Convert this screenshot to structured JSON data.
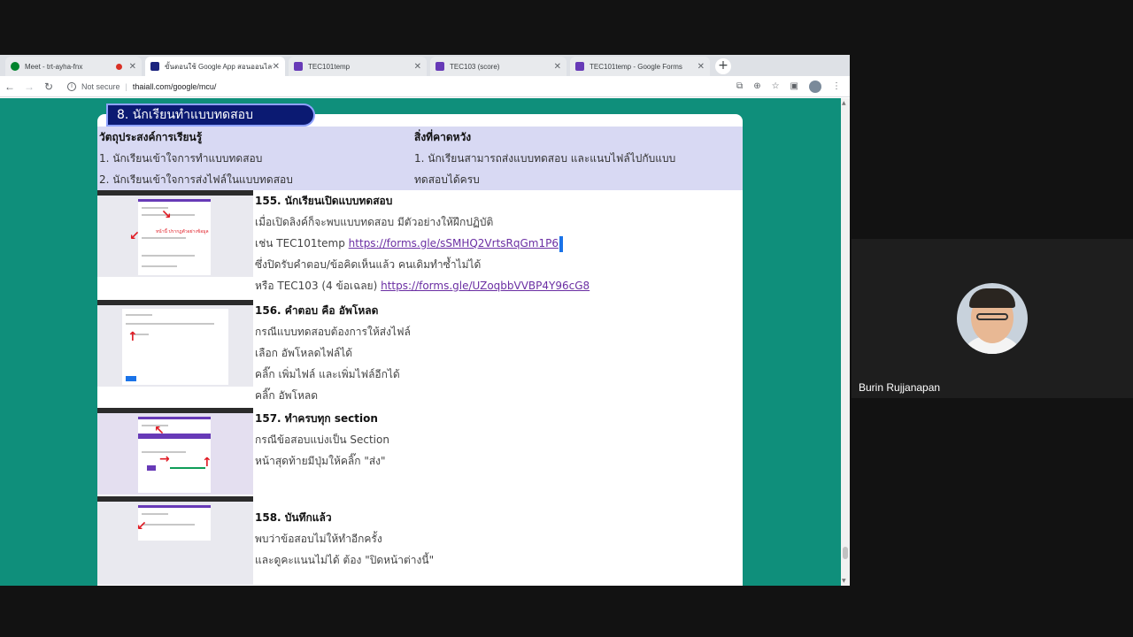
{
  "browser": {
    "tabs": [
      {
        "label": "Meet - trt-ayha-fnx",
        "fav_color": "#00832d",
        "recording": true,
        "active": false
      },
      {
        "label": "ขั้นตอนใช้ Google App สอนออนไลน์",
        "fav_color": "#1a237e",
        "recording": false,
        "active": true
      },
      {
        "label": "TEC101temp",
        "fav_color": "#673ab7",
        "recording": false,
        "active": false
      },
      {
        "label": "TEC103 (score)",
        "fav_color": "#673ab7",
        "recording": false,
        "active": false
      },
      {
        "label": "TEC101temp - Google Forms",
        "fav_color": "#673ab7",
        "recording": false,
        "active": false
      }
    ],
    "new_tab_symbol": "+",
    "close_symbol": "✕",
    "security_label": "Not secure",
    "url": "thaiall.com/google/mcu/"
  },
  "slide": {
    "banner": "8. นักเรียนทำแบบทดสอบ",
    "objectives_heading": "วัตถุประสงค์การเรียนรู้",
    "objectives": [
      "1. นักเรียนเข้าใจการทำแบบทดสอบ",
      "2. นักเรียนเข้าใจการส่งไฟล์ในแบบทดสอบ"
    ],
    "expected_heading": "สิ่งที่คาดหวัง",
    "expected": [
      "1. นักเรียนสามารถส่งแบบทดสอบ และแนบไฟล์ไปกับแบบ",
      "ทดสอบได้ครบ"
    ],
    "steps": [
      {
        "title": "155. นักเรียนเปิดแบบทดสอบ",
        "lines": [
          "เมื่อเปิดลิงค์ก็จะพบแบบทดสอบ มีตัวอย่างให้ฝึกปฏิบัติ",
          "เช่น TEC101temp ",
          "ซึ่งปิดรับคำตอบ/ข้อคิดเห็นแล้ว คนเดิมทำซ้ำไม่ได้",
          "หรือ TEC103 (4 ข้อเฉลย) "
        ],
        "link1": "https://forms.gle/sSMHQ2VrtsRqGm1P6",
        "link2": "https://forms.gle/UZoqbbVVBP4Y96cG8"
      },
      {
        "title": "156. คำตอบ คือ อัพโหลด",
        "lines": [
          "กรณีแบบทดสอบต้องการให้ส่งไฟล์",
          "เลือก อัพโหลดไฟล์ได้",
          "คลิ๊ก เพิ่มไฟล์ และเพิ่มไฟล์อีกได้",
          "คลิ๊ก อัพโหลด"
        ]
      },
      {
        "title": "157. ทำครบทุก section",
        "lines": [
          "กรณีข้อสอบแบ่งเป็น Section",
          "หน้าสุดท้ายมีปุ่มให้คลิ๊ก \"ส่ง\""
        ]
      },
      {
        "title": "158. บันทึกแล้ว",
        "lines": [
          "พบว่าข้อสอบไม่ให้ทำอีกครั้ง",
          "และดูคะแนนไม่ได้ ต้อง \"ปิดหน้าต่างนี้\""
        ]
      }
    ],
    "thumb_caption": "หน้านี้ ปรากฏตัวอย่างข้อมูล"
  },
  "participant": {
    "name": "Burin Rujjanapan"
  }
}
